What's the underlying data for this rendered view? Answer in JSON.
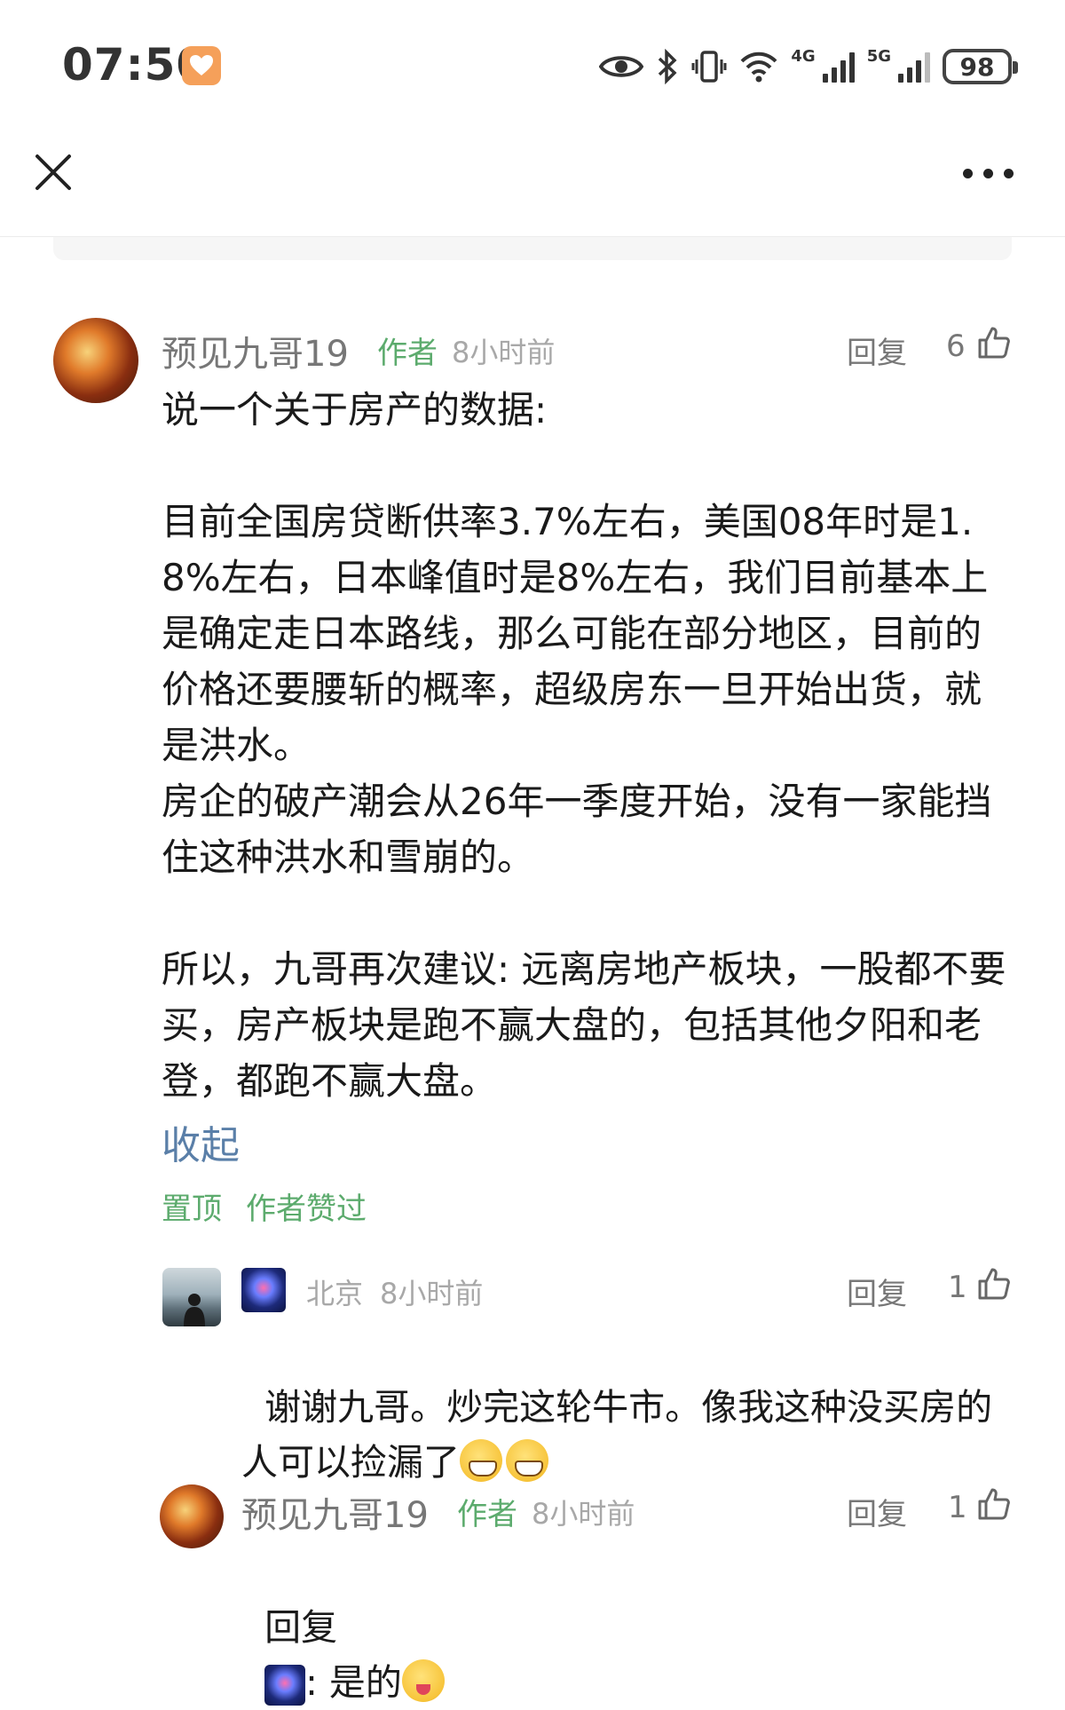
{
  "status_bar": {
    "time": "07:50",
    "net_4g": "4G",
    "net_5g": "5G",
    "battery": "98"
  },
  "comment": {
    "author": "预见九哥19",
    "author_tag": "作者",
    "time": "8小时前",
    "reply_label": "回复",
    "likes": "6",
    "text": "说一个关于房产的数据:\n\n目前全国房贷断供率3.7%左右，美国08年时是1.8%左右，日本峰值时是8%左右，我们目前基本上是确定走日本路线，那么可能在部分地区，目前的价格还要腰斩的概率，超级房东一旦开始出货，就是洪水。\n房企的破产潮会从26年一季度开始，没有一家能挡住这种洪水和雪崩的。\n\n所以，九哥再次建议: 远离房地产板块，一股都不要买，房产板块是跑不赢大盘的，包括其他夕阳和老登，都跑不赢大盘。",
    "collapse_label": "收起",
    "tags": [
      "置顶",
      "作者赞过"
    ]
  },
  "replies": [
    {
      "location": "北京",
      "time": "8小时前",
      "reply_label": "回复",
      "likes": "1",
      "text": "谢谢九哥。炒完这轮牛市。像我这种没买房的人可以捡漏了"
    },
    {
      "author": "预见九哥19",
      "author_tag": "作者",
      "time": "8小时前",
      "reply_label": "回复",
      "likes": "1",
      "prefix": "回复",
      "suffix": ": 是的"
    }
  ],
  "colors": {
    "author_tag": "#5cab6d",
    "link": "#5a7fa8",
    "meta": "#a8a8a8"
  }
}
